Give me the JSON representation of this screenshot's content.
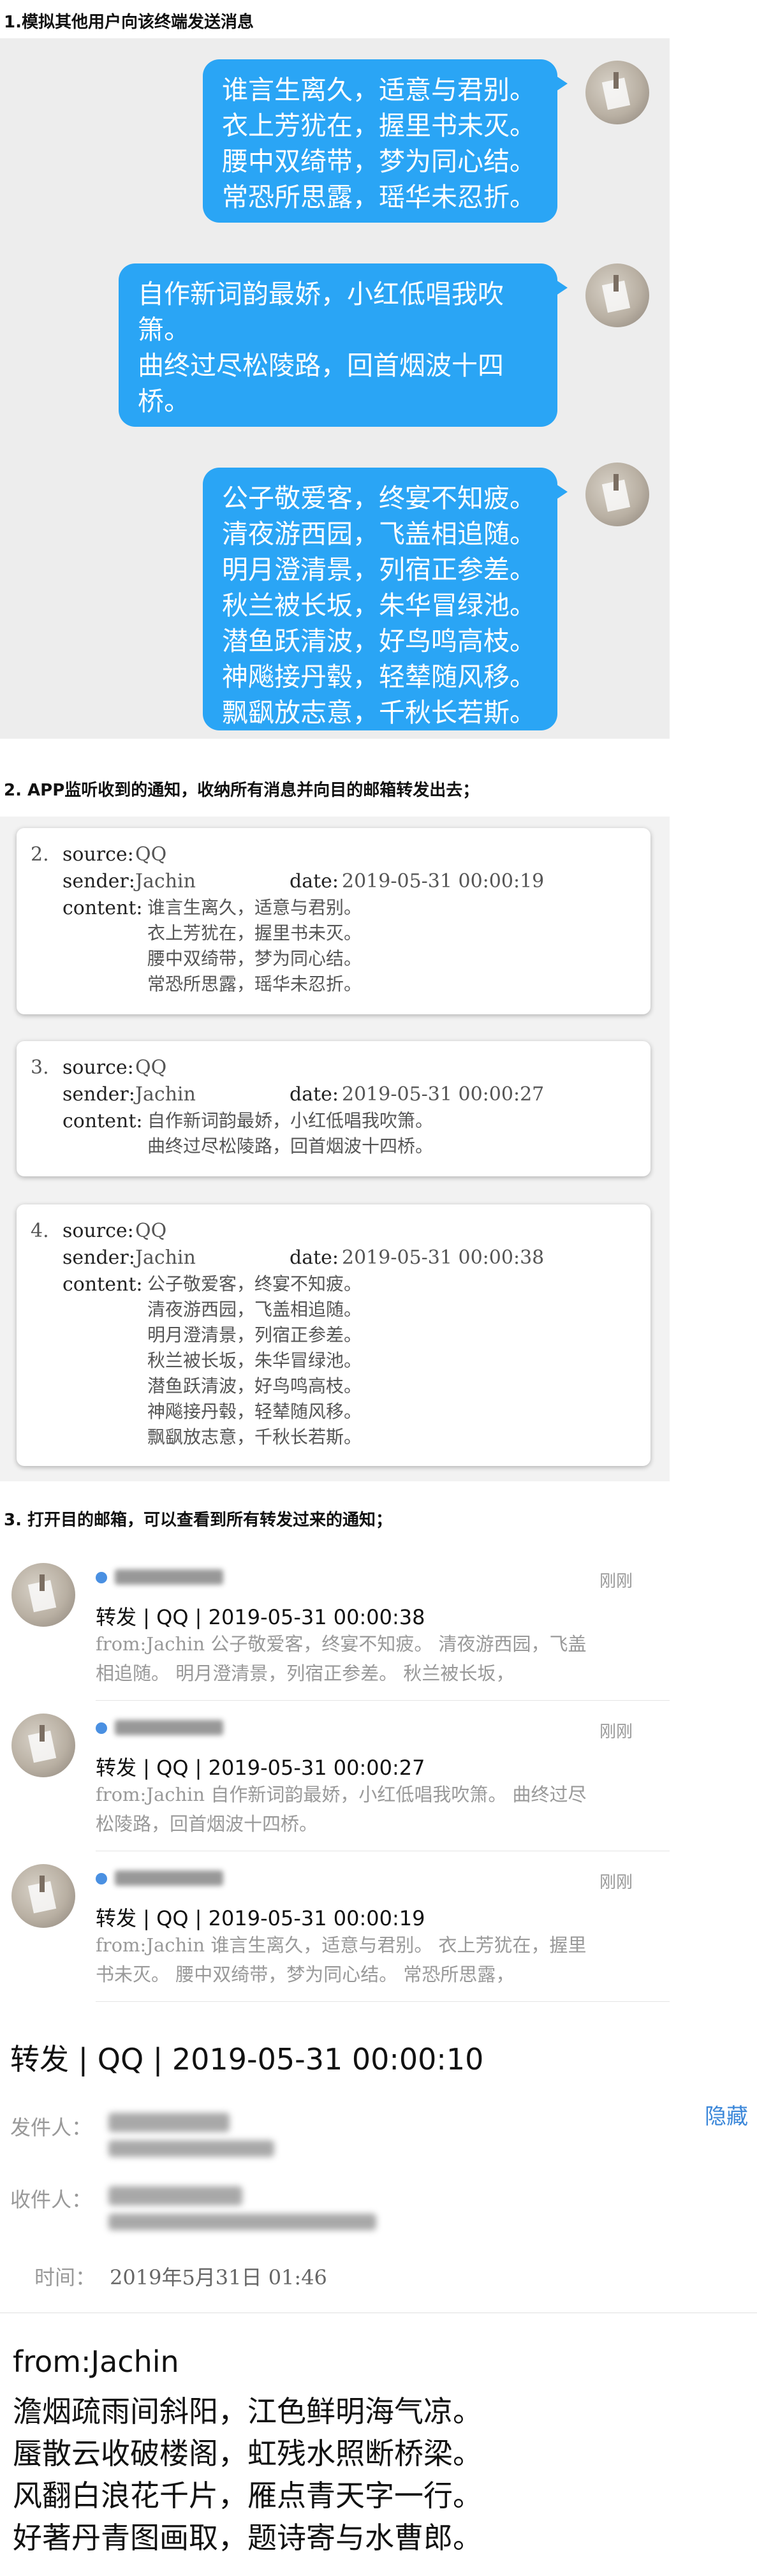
{
  "steps": {
    "s1": "1.模拟其他用户向该终端发送消息",
    "s2": "2. APP监听收到的通知，收纳所有消息并向目的邮箱转发出去；",
    "s3": "3. 打开目的邮箱，可以查看到所有转发过来的通知；"
  },
  "chat": {
    "messages": [
      {
        "text": "谁言生离久，适意与君别。\n衣上芳犹在，握里书未灭。\n腰中双绮带，梦为同心结。\n常恐所思露，瑶华未忍折。"
      },
      {
        "text": "自作新词韵最娇，小红低唱我吹箫。\n曲终过尽松陵路，回首烟波十四桥。"
      },
      {
        "text": "公子敬爱客，终宴不知疲。\n清夜游西园，飞盖相追随。\n明月澄清景，列宿正参差。\n秋兰被长坂，朱华冒绿池。\n潜鱼跃清波，好鸟鸣高枝。\n神飚接丹毂，轻辇随风移。\n飘飖放志意，千秋长若斯。"
      }
    ]
  },
  "notifications": {
    "labels": {
      "source": "source:",
      "sender": "sender:",
      "date": "date:",
      "content": "content:"
    },
    "cards": [
      {
        "index": "2.",
        "source": "QQ",
        "sender": "Jachin",
        "date": "2019-05-31 00:00:19",
        "content": "谁言生离久，适意与君别。\n衣上芳犹在，握里书未灭。\n腰中双绮带，梦为同心结。\n常恐所思露，瑶华未忍折。"
      },
      {
        "index": "3.",
        "source": "QQ",
        "sender": "Jachin",
        "date": "2019-05-31 00:00:27",
        "content": "自作新词韵最娇，小红低唱我吹箫。\n曲终过尽松陵路，回首烟波十四桥。"
      },
      {
        "index": "4.",
        "source": "QQ",
        "sender": "Jachin",
        "date": "2019-05-31 00:00:38",
        "content": "公子敬爱客，终宴不知疲。\n清夜游西园，飞盖相追随。\n明月澄清景，列宿正参差。\n秋兰被长坂，朱华冒绿池。\n潜鱼跃清波，好鸟鸣高枝。\n神飚接丹毂，轻辇随风移。\n飘飖放志意，千秋长若斯。"
      }
    ]
  },
  "mail_list": {
    "items": [
      {
        "time": "刚刚",
        "subject": "转发 | QQ | 2019-05-31 00:00:38",
        "preview": "from:Jachin 公子敬爱客，终宴不知疲。 清夜游西园，飞盖\n相追随。 明月澄清景，列宿正参差。 秋兰被长坂，"
      },
      {
        "time": "刚刚",
        "subject": "转发 | QQ | 2019-05-31 00:00:27",
        "preview": "from:Jachin 自作新词韵最娇，小红低唱我吹箫。 曲终过尽\n松陵路，回首烟波十四桥。"
      },
      {
        "time": "刚刚",
        "subject": "转发 | QQ | 2019-05-31 00:00:19",
        "preview": "from:Jachin 谁言生离久，适意与君别。 衣上芳犹在，握里\n书未灭。 腰中双绮带，梦为同心结。 常恐所思露，"
      }
    ]
  },
  "open_mail": {
    "subject": "转发 | QQ | 2019-05-31 00:00:10",
    "hide": "隐藏",
    "sender_label": "发件人：",
    "recipient_label": "收件人：",
    "time_label": "时间：",
    "time_value": "2019年5月31日 01:46",
    "body_from": "from:Jachin",
    "body": "澹烟疏雨间斜阳，江色鲜明海气凉。\n蜃散云收破楼阁，虹残水照断桥梁。\n风翻白浪花千片，雁点青天字一行。\n好著丹青图画取，题诗寄与水曹郎。"
  },
  "colors": {
    "bubble": "#2aa5f5",
    "accent_link": "#3b87d9",
    "unread_dot": "#4a90e2"
  }
}
